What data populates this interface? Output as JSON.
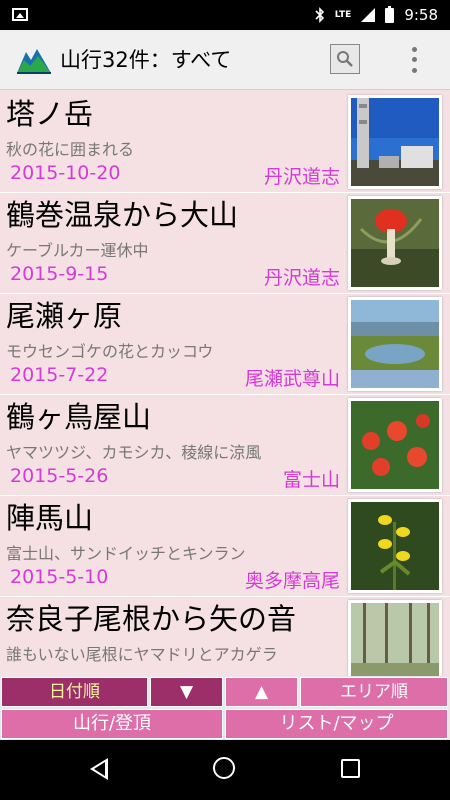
{
  "status_bar": {
    "time": "9:58",
    "network": "LTE",
    "icons": [
      "image-icon",
      "bluetooth-icon",
      "signal-icon",
      "battery-icon"
    ]
  },
  "app_bar": {
    "title": "山行32件：すべて",
    "icons": [
      "mountain-logo-icon",
      "search-icon",
      "overflow-menu-icon"
    ]
  },
  "records": [
    {
      "title": "塔ノ岳",
      "subtitle": "秋の花に囲まれる",
      "date": "2015-10-20",
      "area": "丹沢道志",
      "thumb": "thumb-1"
    },
    {
      "title": "鶴巻温泉から大山",
      "subtitle": "ケーブルカー運休中",
      "date": "2015-9-15",
      "area": "丹沢道志",
      "thumb": "thumb-2"
    },
    {
      "title": "尾瀬ヶ原",
      "subtitle": "モウセンゴケの花とカッコウ",
      "date": "2015-7-22",
      "area": "尾瀬武尊山",
      "thumb": "thumb-3"
    },
    {
      "title": "鶴ヶ鳥屋山",
      "subtitle": "ヤマツツジ、カモシカ、稜線に涼風",
      "date": "2015-5-26",
      "area": "富士山",
      "thumb": "thumb-4"
    },
    {
      "title": "陣馬山",
      "subtitle": "富士山、サンドイッチとキンラン",
      "date": "2015-5-10",
      "area": "奥多摩高尾",
      "thumb": "thumb-5"
    },
    {
      "title": "奈良子尾根から矢の音",
      "subtitle": "誰もいない尾根にヤマドリとアカゲラ",
      "date": "",
      "area": "",
      "thumb": "thumb-6"
    }
  ],
  "sort_bar": {
    "date_label": "日付順",
    "down_label": "▼",
    "up_label": "▲",
    "area_label": "エリア順"
  },
  "action_bar": {
    "climb_label": "山行/登頂",
    "map_label": "リスト/マップ"
  },
  "colors": {
    "accent": "#d63ad6",
    "active_button": "#9c2e6a",
    "button": "#dd6ea8",
    "row_background": "#f5e1e4"
  }
}
